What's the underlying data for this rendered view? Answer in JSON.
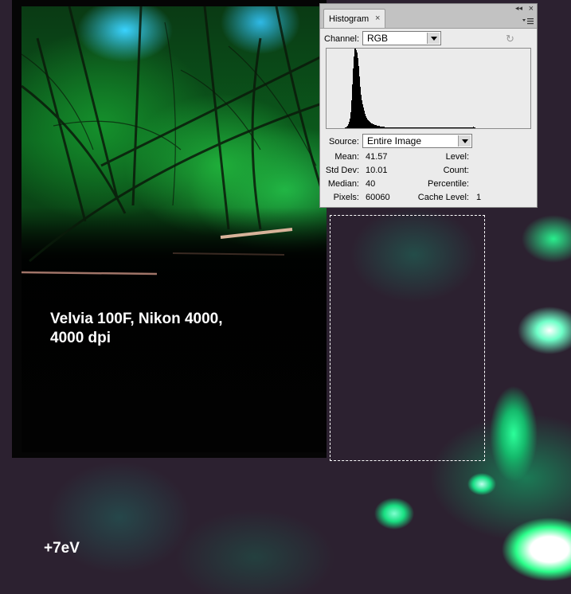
{
  "photo": {
    "caption_line1": "Velvia 100F, Nikon 4000,",
    "caption_line2": "4000 dpi"
  },
  "exposure_label": "+7eV",
  "histogram_panel": {
    "tab_title": "Histogram",
    "tab_close": "×",
    "window_close": "×",
    "window_collapse": "◂◂",
    "channel_label": "Channel:",
    "channel_value": "RGB",
    "source_label": "Source:",
    "source_value": "Entire Image",
    "stats_left": [
      {
        "label": "Mean:",
        "value": "41.57"
      },
      {
        "label": "Std Dev:",
        "value": "10.01"
      },
      {
        "label": "Median:",
        "value": "40"
      },
      {
        "label": "Pixels:",
        "value": "60060"
      }
    ],
    "stats_right": [
      {
        "label": "Level:",
        "value": ""
      },
      {
        "label": "Count:",
        "value": ""
      },
      {
        "label": "Percentile:",
        "value": ""
      },
      {
        "label": "Cache Level:",
        "value": "1"
      }
    ],
    "histogram_levels": [
      0,
      0,
      0,
      0,
      0,
      0,
      0,
      0,
      0,
      0,
      0,
      0,
      0,
      0,
      0,
      0,
      0,
      0,
      0,
      0,
      0,
      0,
      0,
      1,
      1,
      2,
      3,
      5,
      8,
      12,
      20,
      35,
      55,
      75,
      90,
      100,
      100,
      98,
      95,
      88,
      78,
      65,
      52,
      42,
      35,
      30,
      26,
      22,
      18,
      15,
      13,
      11,
      10,
      9,
      8,
      7,
      6,
      6,
      5,
      5,
      4,
      4,
      4,
      3,
      3,
      3,
      3,
      2,
      2,
      2,
      2,
      2,
      2,
      1,
      1,
      1,
      1,
      1,
      1,
      1,
      1,
      1,
      1,
      1,
      1,
      1,
      1,
      1,
      1,
      1,
      1,
      1,
      1,
      1,
      1,
      1,
      1,
      1,
      1,
      1,
      1,
      1,
      1,
      1,
      1,
      1,
      1,
      1,
      1,
      1,
      1,
      1,
      1,
      1,
      1,
      1,
      1,
      1,
      1,
      1,
      1,
      1,
      1,
      1,
      1,
      1,
      1,
      1,
      1,
      1,
      1,
      1,
      1,
      1,
      1,
      1,
      1,
      1,
      1,
      1,
      1,
      1,
      1,
      1,
      1,
      1,
      1,
      1,
      1,
      1,
      1,
      1,
      1,
      1,
      1,
      1,
      1,
      1,
      1,
      1,
      1,
      1,
      1,
      1,
      1,
      1,
      1,
      1,
      1,
      1,
      1,
      1,
      1,
      1,
      1,
      1,
      1,
      1,
      1,
      1,
      1,
      1,
      1,
      1,
      2,
      1,
      1,
      0,
      0,
      0,
      0,
      0,
      0,
      0,
      0,
      0,
      0,
      0,
      0,
      0,
      0,
      0,
      0,
      0,
      0,
      0,
      0,
      0,
      0,
      0,
      0,
      0,
      0,
      0,
      0,
      0,
      0,
      0,
      0,
      0,
      0,
      0,
      0,
      0,
      0,
      0,
      0,
      0,
      0,
      0,
      0,
      0,
      0,
      0,
      0,
      0,
      0,
      0,
      0,
      0,
      0,
      0,
      0,
      0,
      0,
      0,
      0,
      0,
      0,
      0,
      0,
      0,
      0,
      0,
      0,
      0,
      0,
      0,
      0,
      0,
      0
    ]
  },
  "colors": {
    "highlight_green": "#1adf86",
    "background_purple": "#2c2130"
  }
}
